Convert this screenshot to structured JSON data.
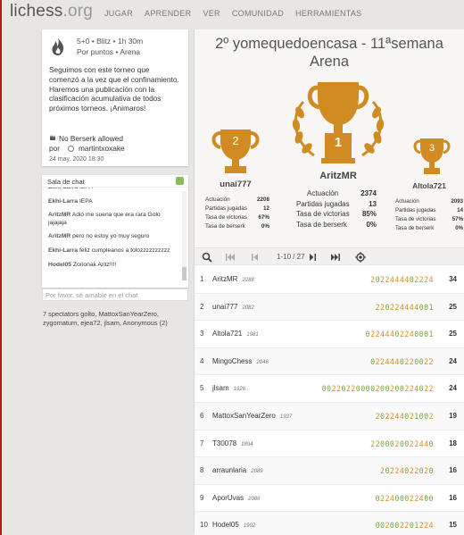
{
  "header": {
    "logo": "lichess",
    "logo_ext": ".org",
    "nav": [
      "JUGAR",
      "APRENDER",
      "VER",
      "COMUNIDAD",
      "HERRAMIENTAS"
    ]
  },
  "info": {
    "line1": "5+0 • Blitz • 1h 30m",
    "line2": "Por puntos • Arena",
    "description": "Seguimos con este torneo que comenzó a la vez que el confinamiento. Haremos una publicación con la clasificación acumulativa de todos próximos torneos. ¡Animaros!",
    "berserk": "No Berserk allowed",
    "por_label": "por",
    "creator": "martintxoxake",
    "date": "24 may. 2020 18:30"
  },
  "chat": {
    "title": "Sala de chat",
    "messages": [
      {
        "user": "Ekhi-Larra",
        "text": "IEPA"
      },
      {
        "user": "AritzMR",
        "text": "Adió me suena que era rara Golo jajajaja"
      },
      {
        "user": "AritzMR",
        "text": "pero no estoy yo muy seguro"
      },
      {
        "user": "Ekhi-Larra",
        "text": "feliz cumpleanos a tolozzzzzzzzzz"
      },
      {
        "user": "Hodel05",
        "text": "Zorionak Aritz!!!!"
      }
    ],
    "placeholder": "Por favor, sé amable en el chat",
    "spectators": "7 spectators golto, MattoxSanYearZero, zygomatum, ejea72, jlsam, Anonymous (2)"
  },
  "podium": {
    "title": "2º yomequedoencasa - 11ªsemana Arena",
    "labels": {
      "performance": "Actuación",
      "games": "Partidas jugadas",
      "winrate": "Tasa de victorias",
      "berserk": "Tasa de berserk"
    },
    "first": {
      "place": "1",
      "name": "AritzMR",
      "performance": "2374",
      "games": "13",
      "winrate": "85%",
      "berserk": "0%"
    },
    "second": {
      "place": "2",
      "name": "unai777",
      "performance": "2208",
      "games": "12",
      "winrate": "67%",
      "berserk": "0%"
    },
    "third": {
      "place": "3",
      "name": "Altola721",
      "performance": "2093",
      "games": "14",
      "winrate": "57%",
      "berserk": "0%"
    }
  },
  "pager": {
    "count": "1-10 / 27"
  },
  "standings": [
    {
      "rank": "1",
      "name": "AritzMR",
      "rating": "2288",
      "seq": "2022444402224",
      "score": "34"
    },
    {
      "rank": "2",
      "name": "unai777",
      "rating": "2082",
      "seq": "220224444001",
      "score": "25"
    },
    {
      "rank": "3",
      "name": "Altola721",
      "rating": "1981",
      "seq": "02244402240001",
      "score": "25"
    },
    {
      "rank": "4",
      "name": "MingoChess",
      "rating": "2046",
      "seq": "0224440220022",
      "score": "24"
    },
    {
      "rank": "5",
      "name": "jlsam",
      "rating": "1926",
      "seq": "00220220000200200224022",
      "score": "24"
    },
    {
      "rank": "6",
      "name": "MattoxSanYearZero",
      "rating": "1937",
      "seq": "202244021002",
      "score": "19"
    },
    {
      "rank": "7",
      "name": "T30078",
      "rating": "1894",
      "seq": "2200020022440",
      "score": "18"
    },
    {
      "rank": "8",
      "name": "arraunlaria",
      "rating": "2089",
      "seq": "20224022020",
      "score": "16"
    },
    {
      "rank": "9",
      "name": "AporUvas",
      "rating": "2086",
      "seq": "022400022400",
      "score": "16"
    },
    {
      "rank": "10",
      "name": "Hodel05",
      "rating": "1902",
      "seq": "002002201224",
      "score": "15"
    }
  ],
  "colors": {
    "accent_red": "#b81a1a",
    "trophy_gold": "#d08c22",
    "seq_orange": "#d4902e",
    "seq_green": "#7aa344"
  }
}
